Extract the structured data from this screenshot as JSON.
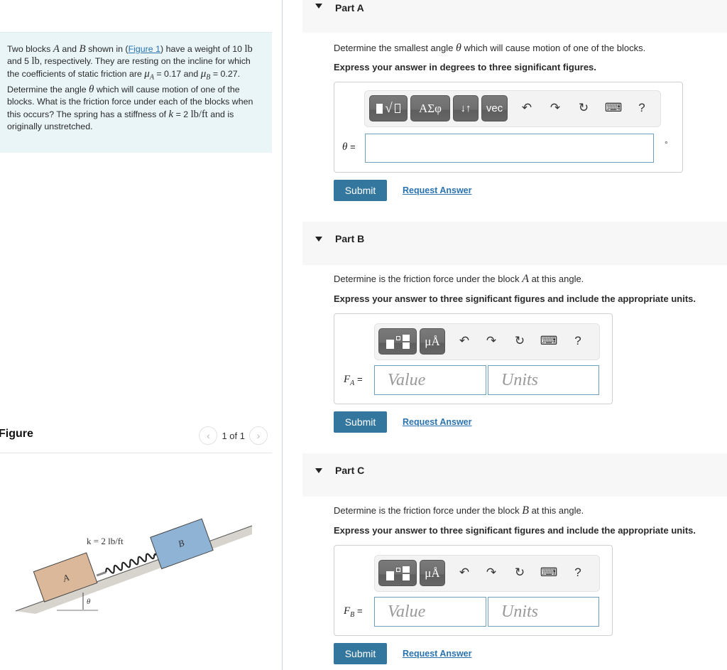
{
  "problem": {
    "t1": "Two blocks ",
    "blockA": "A",
    "t2": " and ",
    "blockB": "B",
    "t3": " shown in (",
    "figure_link": "Figure 1",
    "t4": ") have a weight of 10 ",
    "unit_lb1": "lb",
    "t5": " and 5 ",
    "unit_lb2": "lb",
    "t6": ", respectively. They are resting on the incline for which the coefficients of static friction are ",
    "mu": "μ",
    "subA": "A",
    "t7": " = 0.17 and ",
    "subB": "B",
    "t8": " = 0.27. Determine the angle ",
    "theta": "θ",
    "t9": " which will cause motion of one of the blocks. What is the friction force under each of the blocks when this occurs? The spring has a stiffness of ",
    "k": "k",
    "t10": " = 2 ",
    "unit_k": "lb/ft",
    "t11": " and is originally unstretched."
  },
  "figure": {
    "title": "Figure",
    "pager_text": "1 of 1",
    "prev_icon": "‹",
    "next_icon": "›",
    "spring_label": "k = 2 lb/ft",
    "block_a_label": "A",
    "block_b_label": "B",
    "angle_label": "θ",
    "colors": {
      "block_a": "#dcb89a",
      "block_b": "#8fb3d4",
      "ground": "#d6d4cc"
    }
  },
  "parts": [
    {
      "title": "Part A",
      "question_pre": "Determine the smallest angle ",
      "question_sym": "θ",
      "question_post": " which will cause motion of one of the blocks.",
      "instruction": "Express your answer in degrees to three significant figures.",
      "toolbar_buttons": [
        "√",
        "ΑΣφ",
        "↓↑",
        "vec"
      ],
      "answer_label": "θ",
      "answer_value": "",
      "unit_suffix": "°",
      "submit": "Submit",
      "request": "Request Answer"
    },
    {
      "title": "Part B",
      "question_pre": "Determine is the friction force under the block ",
      "question_sym": "A",
      "question_post": " at this angle.",
      "instruction": "Express your answer to three significant figures and include the appropriate units.",
      "toolbar_buttons": [
        "templates",
        "μÅ"
      ],
      "answer_label": "F",
      "answer_sub": "A",
      "value_placeholder": "Value",
      "units_placeholder": "Units",
      "submit": "Submit",
      "request": "Request Answer"
    },
    {
      "title": "Part C",
      "question_pre": "Determine is the friction force under the block ",
      "question_sym": "B",
      "question_post": " at this angle.",
      "instruction": "Express your answer to three significant figures and include the appropriate units.",
      "toolbar_buttons": [
        "templates",
        "μÅ"
      ],
      "answer_label": "F",
      "answer_sub": "B",
      "value_placeholder": "Value",
      "units_placeholder": "Units",
      "submit": "Submit",
      "request": "Request Answer"
    }
  ],
  "toolbar_icons": {
    "undo": "↶",
    "redo": "↷",
    "reset": "↻",
    "keyboard": "⌨",
    "help": "?"
  },
  "equals": "=",
  "colors": {
    "submit_bg": "#33779e",
    "link": "#2a73b0",
    "problem_bg": "#eaf5f7",
    "part_header_bg": "#f7f7f7"
  }
}
